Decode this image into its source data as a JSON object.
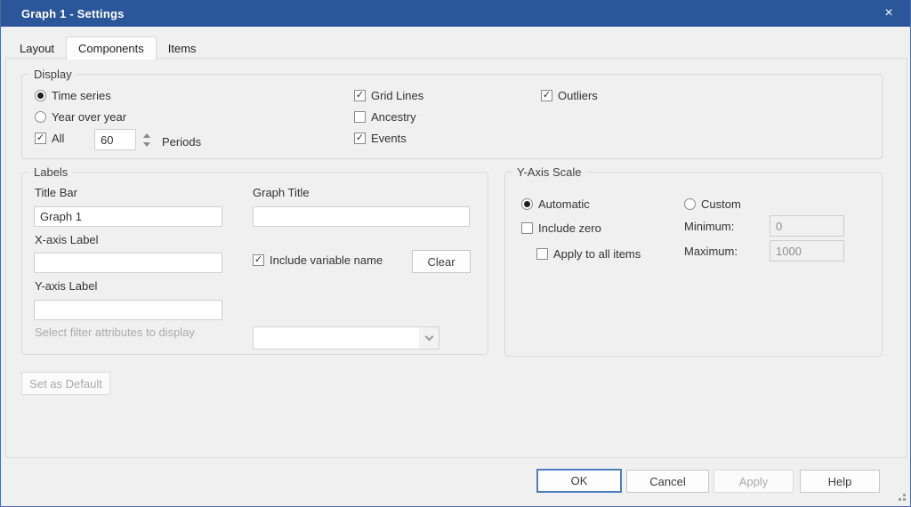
{
  "window": {
    "title": "Graph 1 - Settings"
  },
  "icons": {
    "check": "✓",
    "close": "×"
  },
  "colors": {
    "titlebar": "#2b579a",
    "default_button_border": "#4a7ebd"
  },
  "tabs": [
    {
      "label": "Layout",
      "active": false
    },
    {
      "label": "Components",
      "active": true
    },
    {
      "label": "Items",
      "active": false
    }
  ],
  "display": {
    "legend": "Display",
    "time_series_label": "Time series",
    "year_over_year_label": "Year over year",
    "all_label": "All",
    "periods_value": "60",
    "periods_label": "Periods",
    "grid_lines_label": "Grid Lines",
    "ancestry_label": "Ancestry",
    "events_label": "Events",
    "outliers_label": "Outliers"
  },
  "labels_group": {
    "legend": "Labels",
    "title_bar_label": "Title Bar",
    "title_bar_value": "Graph 1",
    "xaxis_label": "X-axis Label",
    "xaxis_value": "",
    "yaxis_label": "Y-axis Label",
    "yaxis_value": "",
    "filter_hint": "Select filter attributes to display",
    "filter_select_value": "",
    "graph_title_label": "Graph Title",
    "graph_title_value": "",
    "include_variable_label": "Include variable name",
    "clear_button": "Clear"
  },
  "yaxis_scale": {
    "legend": "Y-Axis Scale",
    "automatic_label": "Automatic",
    "custom_label": "Custom",
    "include_zero_label": "Include zero",
    "apply_all_label": "Apply to all items",
    "minimum_label": "Minimum:",
    "minimum_value": "0",
    "maximum_label": "Maximum:",
    "maximum_value": "1000"
  },
  "buttons": {
    "set_default": "Set as Default",
    "ok": "OK",
    "cancel": "Cancel",
    "apply": "Apply",
    "help": "Help"
  }
}
